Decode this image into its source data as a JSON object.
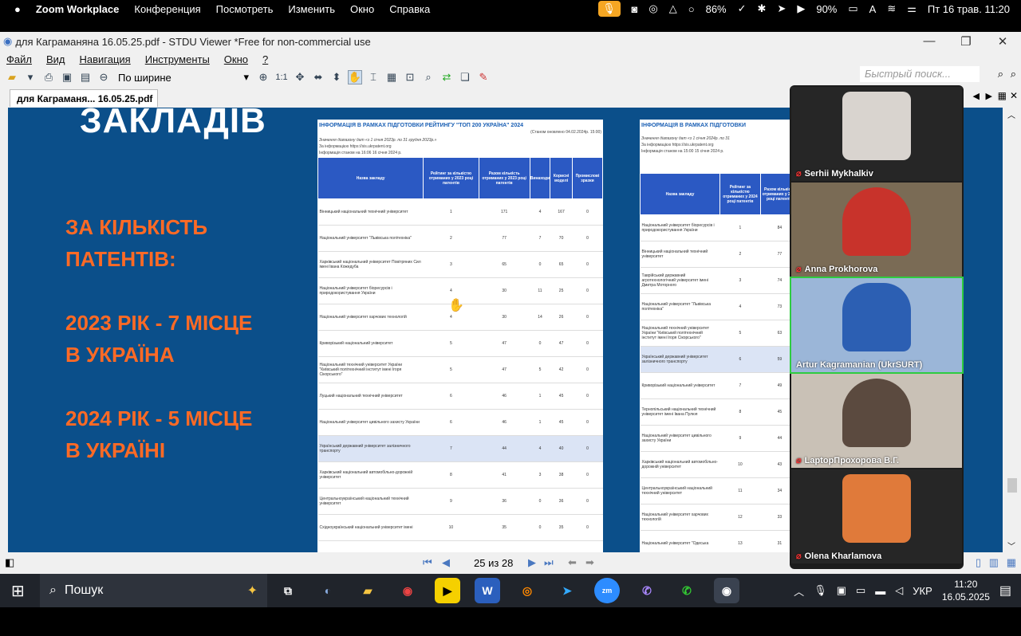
{
  "macbar": {
    "apple": "",
    "app": "Zoom Workplace",
    "menus": [
      "Конференция",
      "Посмотреть",
      "Изменить",
      "Окно",
      "Справка"
    ],
    "battery1": "86%",
    "battery2": "90%",
    "input": "A",
    "datetime": "Пт 16 трав. 11:20"
  },
  "window": {
    "title": "для Каграманяна   16.05.25.pdf - STDU Viewer *Free for non-commercial use",
    "menus": [
      "Файл",
      "Вид",
      "Навигация",
      "Инструменты",
      "Окно",
      "?"
    ],
    "zoom": "По ширине",
    "zoom_11": "1:1",
    "quick_search": "Быстрый поиск...",
    "tab": "для Каграманя...  16.05.25.pdf",
    "page_indicator": "25 из 28"
  },
  "slide": {
    "title": "ЗАКЛАДІВ",
    "line1": "ЗА КІЛЬКІСТЬ",
    "line2": "ПАТЕНТІВ:",
    "line3": "2023 РІК - 7 МІСЦЕ",
    "line4": "В УКРАЇНА",
    "line5": "2024 РІК - 5 МІСЦЕ",
    "line6": "В УКРАЇНІ"
  },
  "page1": {
    "heading": "ІНФОРМАЦІЯ В РАМКАХ ПІДГОТОВКИ РЕЙТИНГУ \"ТОП 200 УКРАЇНА\" 2024",
    "updated": "(Станом оновлено 04.02.2024р. 15:00)",
    "range": "Значення діапазону дат «з 1 січня 2023р. по 31 грудня 2023р.»",
    "source": "За інформацією https://sis.ukrpatent.org",
    "state": "Інформація станом на 16:06 16 січня 2024 р.",
    "headers": [
      "Назва закладу",
      "Рейтинг за кількістю отриманих у 2023 році патентів",
      "Разом кількість отриманих у 2023 році патентів",
      "Винаходи",
      "Корисні моделі",
      "Промислові зразки"
    ],
    "rows": [
      {
        "name": "Вінницький національний технічний університет",
        "r": "1",
        "t": "171",
        "i": "4",
        "m": "167",
        "p": "0"
      },
      {
        "name": "Національний університет \"Львівська політехніка\"",
        "r": "2",
        "t": "77",
        "i": "7",
        "m": "70",
        "p": "0"
      },
      {
        "name": "Харківський національний університет Повітряних Сил імені Івана Кожедуба",
        "r": "3",
        "t": "65",
        "i": "0",
        "m": "65",
        "p": "0"
      },
      {
        "name": "Національний університет біоресурсів і природокористування України",
        "r": "4",
        "t": "30",
        "i": "11",
        "m": "25",
        "p": "0"
      },
      {
        "name": "Національний університет харчових технологій",
        "r": "4",
        "t": "30",
        "i": "14",
        "m": "26",
        "p": "0"
      },
      {
        "name": "Криворізький національний університет",
        "r": "5",
        "t": "47",
        "i": "0",
        "m": "47",
        "p": "0"
      },
      {
        "name": "Національний технічний університет України \"Київський політехнічний інститут імені Ігоря Сікорського\"",
        "r": "5",
        "t": "47",
        "i": "5",
        "m": "42",
        "p": "0"
      },
      {
        "name": "Луцький національний технічний університет",
        "r": "6",
        "t": "46",
        "i": "1",
        "m": "45",
        "p": "0"
      },
      {
        "name": "Національний університет цивільного захисту України",
        "r": "6",
        "t": "46",
        "i": "1",
        "m": "45",
        "p": "0"
      },
      {
        "name": "Український державний університет залізничного транспорту",
        "r": "7",
        "t": "44",
        "i": "4",
        "m": "40",
        "p": "0",
        "hl": true
      },
      {
        "name": "Харківський національний автомобільно-дорожній університет",
        "r": "8",
        "t": "41",
        "i": "3",
        "m": "38",
        "p": "0"
      },
      {
        "name": "Центральноукраїнський національний технічний університет",
        "r": "9",
        "t": "36",
        "i": "0",
        "m": "36",
        "p": "0"
      },
      {
        "name": "Східноукраїнський національний університет імені",
        "r": "10",
        "t": "35",
        "i": "0",
        "m": "35",
        "p": "0"
      }
    ]
  },
  "page2": {
    "heading": "ІНФОРМАЦІЯ В РАМКАХ ПІДГОТОВКИ",
    "range": "Значення діапазону дат «з 1 січня 2024р. по 31",
    "source": "За інформацією https://sis.ukrpatent.org",
    "state": "Інформація станом на 15:00 15 січня 2024 р.",
    "headers": [
      "Назва закладу",
      "Рейтинг за кількістю отриманих у 2024 році патентів",
      "Разом кількість отриманих у 2024 році патентів"
    ],
    "rows": [
      {
        "name": "Національний університет біоресурсів і природокористування України",
        "r": "1",
        "t": "84"
      },
      {
        "name": "Вінницький національний технічний університет",
        "r": "2",
        "t": "77"
      },
      {
        "name": "Таврійський державний агротехнологічний університет імені Дмитра Моторного",
        "r": "3",
        "t": "74"
      },
      {
        "name": "Національний університет \"Львівська політехніка\"",
        "r": "4",
        "t": "73"
      },
      {
        "name": "Національний технічний університет України \"Київський політехнічний інститут імені Ігоря Сікорського\"",
        "r": "5",
        "t": "63"
      },
      {
        "name": "Український державний університет залізничного транспорту",
        "r": "6",
        "t": "59",
        "hl": true
      },
      {
        "name": "Криворізький національний університет",
        "r": "7",
        "t": "49"
      },
      {
        "name": "Тернопільський національний технічний університет імені Івана Пулюя",
        "r": "8",
        "t": "45"
      },
      {
        "name": "Національний університет цивільного захисту України",
        "r": "9",
        "t": "44"
      },
      {
        "name": "Харківський національний автомобільно-дорожній університет",
        "r": "10",
        "t": "43"
      },
      {
        "name": "Центральноукраїнський національний технічний університет",
        "r": "11",
        "t": "34"
      },
      {
        "name": "Національний університет харчових технологій",
        "r": "12",
        "t": "33"
      },
      {
        "name": "Національний університет \"Одеська",
        "r": "13",
        "t": "31"
      }
    ]
  },
  "participants": [
    {
      "name": "Serhii Mykhalkiv"
    },
    {
      "name": "Anna Prokhorova"
    },
    {
      "name": "Artur Kagramanian (UkrSURT)"
    },
    {
      "name": "LaptopПрохорова В.Г."
    },
    {
      "name": "Olena Kharlamova"
    }
  ],
  "taskbar": {
    "search": "Пошук",
    "lang": "УКР",
    "time": "11:20",
    "date": "16.05.2025"
  }
}
